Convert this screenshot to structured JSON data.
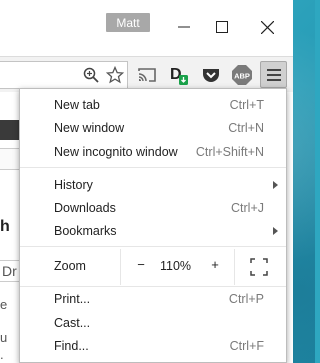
{
  "window": {
    "profile_name": "Matt"
  },
  "toolbar": {
    "icons": [
      "zoom-icon",
      "star-icon",
      "cast-icon",
      "d-extension-icon",
      "pocket-icon",
      "adblock-plus-icon",
      "hamburger-menu-icon"
    ],
    "abp_label": "ABP"
  },
  "menu": {
    "items_top": [
      {
        "label": "New tab",
        "shortcut": "Ctrl+T"
      },
      {
        "label": "New window",
        "shortcut": "Ctrl+N"
      },
      {
        "label": "New incognito window",
        "shortcut": "Ctrl+Shift+N"
      }
    ],
    "items_mid": [
      {
        "label": "History",
        "shortcut": ""
      },
      {
        "label": "Downloads",
        "shortcut": "Ctrl+J"
      },
      {
        "label": "Bookmarks",
        "shortcut": ""
      }
    ],
    "zoom": {
      "label": "Zoom",
      "minus": "−",
      "value": "110%",
      "plus": "+"
    },
    "items_bottom": [
      {
        "label": "Print...",
        "shortcut": "Ctrl+P"
      },
      {
        "label": "Cast...",
        "shortcut": ""
      },
      {
        "label": "Find...",
        "shortcut": "Ctrl+F"
      }
    ]
  },
  "page_fragments": {
    "letter_h": "h",
    "box_text": "Dr",
    "letter_e": "e",
    "letter_u": "u",
    "letter_dot": "."
  },
  "colors": {
    "desktop": "#2ea7c0",
    "menu_border": "#bdbdbd",
    "shortcut_text": "#7a7a7a",
    "menu_button_bg": "#d0d0d0"
  }
}
